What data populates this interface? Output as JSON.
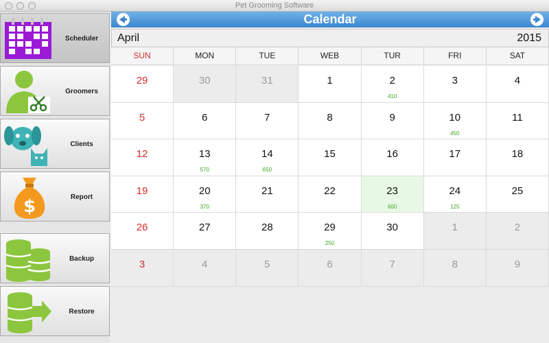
{
  "window": {
    "title": "Pet Grooming Software"
  },
  "sidebar": {
    "items": [
      {
        "label": "Scheduler",
        "icon": "calendar-icon",
        "active": true
      },
      {
        "label": "Groomers",
        "icon": "groomer-scissors-icon"
      },
      {
        "label": "Clients",
        "icon": "dog-cat-icon"
      },
      {
        "label": "Report",
        "icon": "money-bag-icon"
      },
      {
        "label": "Backup",
        "icon": "database-stack-icon"
      },
      {
        "label": "Restore",
        "icon": "database-arrow-icon"
      }
    ]
  },
  "header": {
    "title": "Calendar",
    "prev_icon": "arrow-left-icon",
    "next_icon": "arrow-right-icon"
  },
  "month_bar": {
    "month": "April",
    "year": "2015"
  },
  "calendar": {
    "days": [
      "SUN",
      "MON",
      "TUE",
      "WEB",
      "TUR",
      "FRI",
      "SAT"
    ],
    "weeks": [
      [
        {
          "day": "29",
          "other": false
        },
        {
          "day": "30",
          "other": true
        },
        {
          "day": "31",
          "other": true
        },
        {
          "day": "1"
        },
        {
          "day": "2",
          "amount": "410"
        },
        {
          "day": "3"
        },
        {
          "day": "4"
        }
      ],
      [
        {
          "day": "5"
        },
        {
          "day": "6"
        },
        {
          "day": "7"
        },
        {
          "day": "8"
        },
        {
          "day": "9"
        },
        {
          "day": "10",
          "amount": "450"
        },
        {
          "day": "11"
        }
      ],
      [
        {
          "day": "12"
        },
        {
          "day": "13",
          "amount": "570"
        },
        {
          "day": "14",
          "amount": "650"
        },
        {
          "day": "15"
        },
        {
          "day": "16"
        },
        {
          "day": "17"
        },
        {
          "day": "18"
        }
      ],
      [
        {
          "day": "19"
        },
        {
          "day": "20",
          "amount": "370"
        },
        {
          "day": "21"
        },
        {
          "day": "22"
        },
        {
          "day": "23",
          "amount": "600",
          "selected": true
        },
        {
          "day": "24",
          "amount": "125"
        },
        {
          "day": "25"
        }
      ],
      [
        {
          "day": "26"
        },
        {
          "day": "27"
        },
        {
          "day": "28"
        },
        {
          "day": "29",
          "amount": "250"
        },
        {
          "day": "30"
        },
        {
          "day": "1",
          "other": true
        },
        {
          "day": "2",
          "other": true
        }
      ],
      [
        {
          "day": "3",
          "other": true
        },
        {
          "day": "4",
          "other": true
        },
        {
          "day": "5",
          "other": true
        },
        {
          "day": "6",
          "other": true
        },
        {
          "day": "7",
          "other": true
        },
        {
          "day": "8",
          "other": true
        },
        {
          "day": "9",
          "other": true
        }
      ]
    ]
  },
  "colors": {
    "header": "#4a94d8",
    "sunday": "#d22d2d",
    "amount": "#3ea51f",
    "selected_cell": "#e7f9e4",
    "icon_purple": "#9a1ad6",
    "icon_green": "#8cc63f",
    "icon_teal": "#3fb3b6",
    "icon_orange": "#f39a1e"
  }
}
